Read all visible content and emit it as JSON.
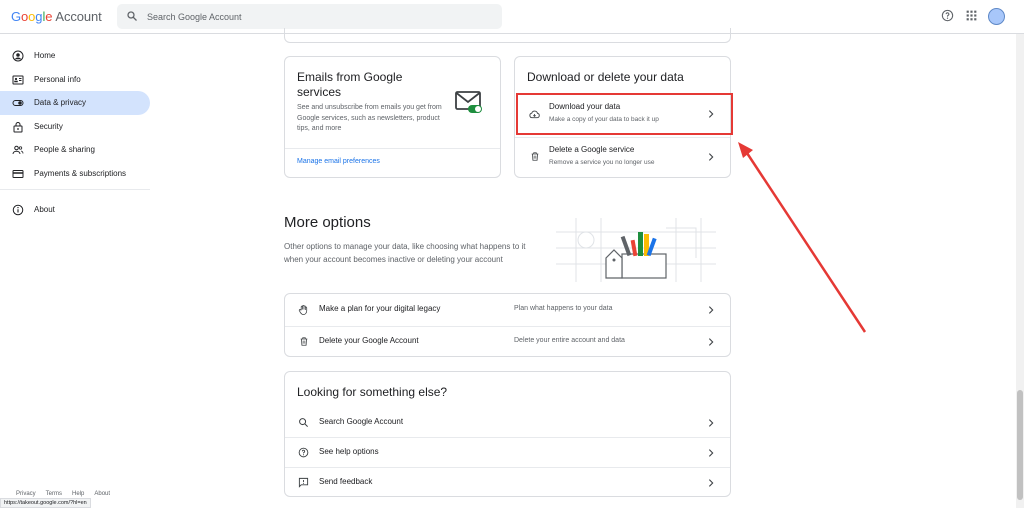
{
  "header": {
    "logo_letters": [
      "G",
      "o",
      "o",
      "g",
      "l",
      "e"
    ],
    "logo_account": "Account",
    "search_placeholder": "Search Google Account",
    "icons": [
      "help-icon",
      "apps-grid-icon",
      "avatar"
    ]
  },
  "sidebar": {
    "items": [
      {
        "label": "Home",
        "icon": "home-icon"
      },
      {
        "label": "Personal info",
        "icon": "personal-info-icon"
      },
      {
        "label": "Data & privacy",
        "icon": "toggle-icon",
        "active": true
      },
      {
        "label": "Security",
        "icon": "lock-icon"
      },
      {
        "label": "People & sharing",
        "icon": "people-icon"
      },
      {
        "label": "Payments & subscriptions",
        "icon": "card-icon"
      }
    ],
    "about": {
      "label": "About",
      "icon": "info-icon"
    },
    "footer": [
      "Privacy",
      "Terms",
      "Help",
      "About"
    ]
  },
  "status_url": "https://takeout.google.com/?hl=en",
  "emails_card": {
    "title": "Emails from Google services",
    "description": "See and unsubscribe from emails you get from Google services, such as newsletters, product tips, and more",
    "link": "Manage email preferences"
  },
  "download_card": {
    "title": "Download or delete your data",
    "rows": [
      {
        "title": "Download your data",
        "subtitle": "Make a copy of your data to back it up",
        "icon": "cloud-download-icon",
        "highlighted": true
      },
      {
        "title": "Delete a Google service",
        "subtitle": "Remove a service you no longer use",
        "icon": "trash-icon"
      }
    ]
  },
  "more_options": {
    "title": "More options",
    "description": "Other options to manage your data, like choosing what happens to it when your account becomes inactive or deleting your account",
    "rows": [
      {
        "title": "Make a plan for your digital legacy",
        "detail": "Plan what happens to your data",
        "icon": "hand-icon"
      },
      {
        "title": "Delete your Google Account",
        "detail": "Delete your entire account and data",
        "icon": "trash-icon"
      }
    ]
  },
  "looking_card": {
    "title": "Looking for something else?",
    "rows": [
      {
        "title": "Search Google Account",
        "icon": "search-icon"
      },
      {
        "title": "See help options",
        "icon": "help-icon"
      },
      {
        "title": "Send feedback",
        "icon": "feedback-icon"
      }
    ]
  },
  "colors": {
    "accent": "#1a73e8",
    "active_bg": "#d3e3fd",
    "annotation": "#e53935",
    "border": "#dadce0"
  }
}
